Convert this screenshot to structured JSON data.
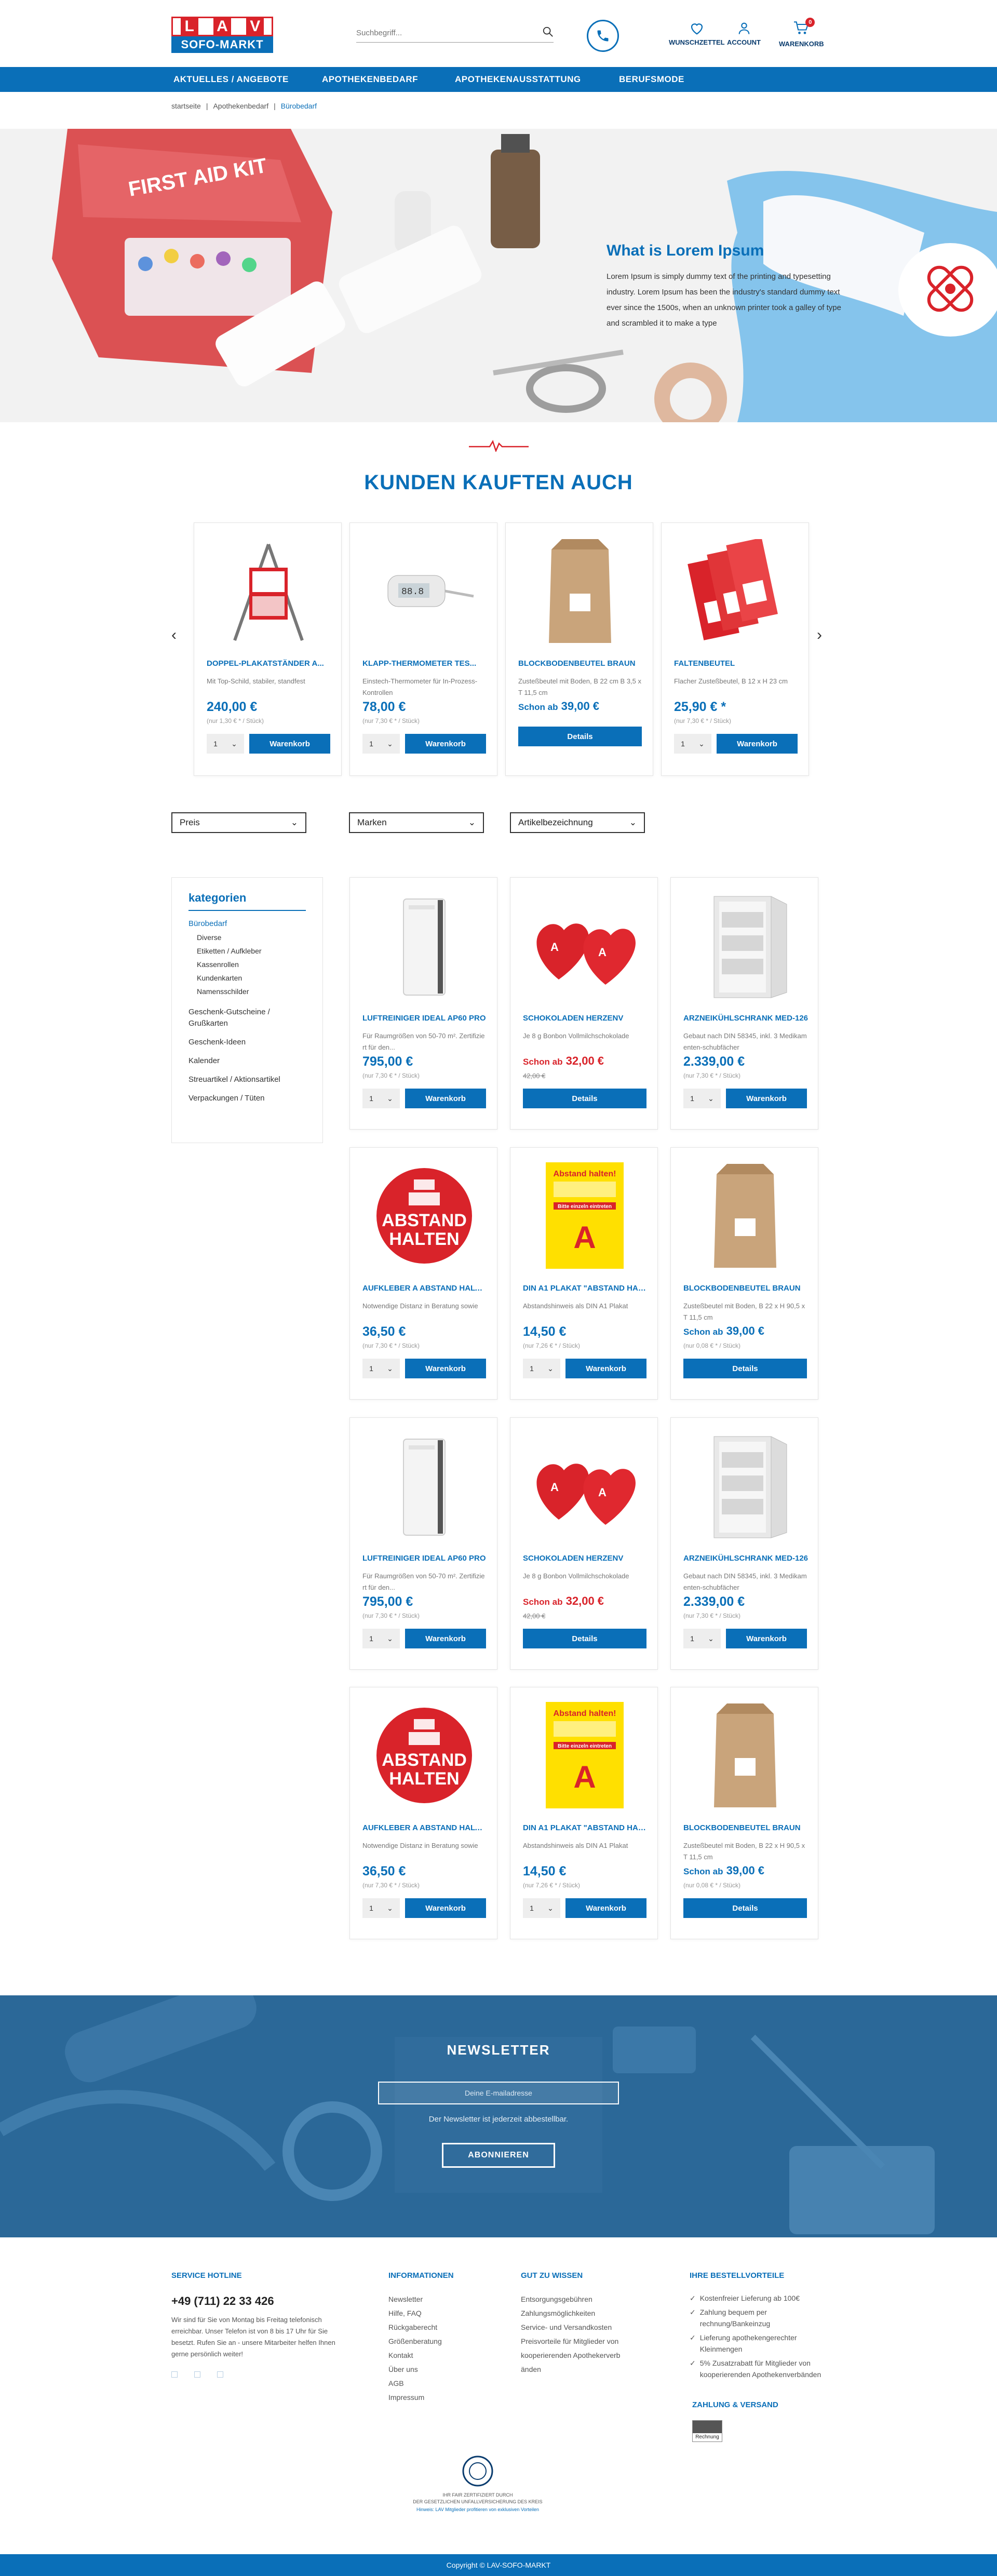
{
  "header": {
    "logo_top": [
      "L",
      "A",
      "V"
    ],
    "logo_bottom": "SOFO-MARKT",
    "search_placeholder": "Suchbegriff...",
    "wishlist_label": "WUNSCHZETTEL",
    "account_label": "ACCOUNT",
    "cart_label": "WARENKORB",
    "cart_count": "0"
  },
  "nav": [
    "AKTUELLES / ANGEBOTE",
    "APOTHEKENBEDARF",
    "APOTHEKENAUSSTATTUNG",
    "BERUFSMODE"
  ],
  "breadcrumb": [
    "startseite",
    "Apothekenbedarf",
    "Bürobedarf"
  ],
  "hero": {
    "title": "What is Lorem Ipsum",
    "text": "Lorem Ipsum is simply dummy text of the printing and typesetting industry. Lorem Ipsum has been the industry's standard dummy text ever since the 1500s, when an unknown printer took a galley of type and scrambled it to make a type",
    "bag_text": "FIRST AID KIT"
  },
  "also_bought": {
    "title": "KUNDEN KAUFTEN AUCH",
    "prev": "‹",
    "next": "›",
    "products": [
      {
        "name": "DOPPEL-PLAKATSTÄNDER A...",
        "desc": "Mit Top-Schild, stabiler, standfest",
        "price": "240,00 €",
        "unit": "(nur 1,30 € * / Stück)",
        "qty": "1",
        "button": "Warenkorb"
      },
      {
        "name": "KLAPP-THERMOMETER TES...",
        "desc": "Einstech-Thermometer für In-Prozess-Kontrollen",
        "price": "78,00 €",
        "unit": "(nur 7,30 € * / Stück)",
        "qty": "1",
        "button": "Warenkorb"
      },
      {
        "name": "BLOCKBODENBEUTEL BRAUN",
        "desc": "Zusteßbeutel mit Boden, B 22 cm B 3,5 x T 11,5 cm",
        "price_prefix": "Schon ab",
        "price": "39,00 €",
        "button": "Details"
      },
      {
        "name": "FALTENBEUTEL",
        "desc": "Flacher Zusteßbeutel, B 12 x H 23 cm",
        "price": "25,90 € *",
        "unit": "(nur 7,30 € * / Stück)",
        "qty": "1",
        "button": "Warenkorb"
      }
    ]
  },
  "filters": [
    "Preis",
    "Marken",
    "Artikelbezeichnung"
  ],
  "sidebar": {
    "title": "kategorien",
    "active": "Bürobedarf",
    "sub": [
      "Diverse",
      "Etiketten / Aufkleber",
      "Kassenrollen",
      "Kundenkarten",
      "Namensschilder"
    ],
    "items": [
      "Geschenk-Gutscheine / Grußkarten",
      "Geschenk-Ideen",
      "Kalender",
      "Streuartikel / Aktionsartikel",
      "Verpackungen / Tüten"
    ]
  },
  "grid_products": [
    {
      "name": "LUFTREINIGER IDEAL AP60 PRO",
      "desc": "Für Raumgrößen von 50-70 m². Zertifizie rt für den...",
      "price": "795,00 €",
      "unit": "(nur 7,30 € * / Stück)",
      "qty": "1",
      "button": "Warenkorb",
      "img": "purifier"
    },
    {
      "name": "SCHOKOLADEN HERZENV",
      "desc": "Je 8 g Bonbon Vollmilchschokolade",
      "price_prefix": "Schon ab",
      "price": "32,00 €",
      "old": "42,00 €",
      "button": "Details",
      "img": "hearts"
    },
    {
      "name": "ARZNEIKÜHLSCHRANK MED-126",
      "desc": "Gebaut nach DIN 58345, inkl. 3 Medikam enten-schubfächer",
      "price": "2.339,00 €",
      "unit": "(nur 7,30 € * / Stück)",
      "qty": "1",
      "button": "Warenkorb",
      "img": "fridge"
    },
    {
      "name": "AUFKLEBER A ABSTAND HALTEN",
      "desc": "Notwendige Distanz in Beratung sowie",
      "price": "36,50 €",
      "unit": "(nur 7,30 € * / Stück)",
      "qty": "1",
      "button": "Warenkorb",
      "img": "sticker"
    },
    {
      "name": "DIN A1 PLAKAT \"ABSTAND HAL...",
      "desc": "Abstandshinweis als DIN A1 Plakat",
      "price": "14,50 €",
      "unit": "(nur 7,26 € * / Stück)",
      "qty": "1",
      "button": "Warenkorb",
      "img": "poster"
    },
    {
      "name": "BLOCKBODENBEUTEL BRAUN",
      "desc": "Zusteßbeutel mit Boden, B 22 x H 90,5 x T 11,5 cm",
      "price_prefix": "Schon ab",
      "price": "39,00 €",
      "unit": "(nur 0,08 € * / Stück)",
      "button": "Details",
      "img": "bag"
    },
    {
      "name": "LUFTREINIGER IDEAL AP60 PRO",
      "desc": "Für Raumgrößen von 50-70 m². Zertifizie rt für den...",
      "price": "795,00 €",
      "unit": "(nur 7,30 € * / Stück)",
      "qty": "1",
      "button": "Warenkorb",
      "img": "purifier"
    },
    {
      "name": "SCHOKOLADEN HERZENV",
      "desc": "Je 8 g Bonbon Vollmilchschokolade",
      "price_prefix": "Schon ab",
      "price": "32,00 €",
      "old": "42,00 €",
      "button": "Details",
      "img": "hearts"
    },
    {
      "name": "ARZNEIKÜHLSCHRANK MED-126",
      "desc": "Gebaut nach DIN 58345, inkl. 3 Medikam enten-schubfächer",
      "price": "2.339,00 €",
      "unit": "(nur 7,30 € * / Stück)",
      "qty": "1",
      "button": "Warenkorb",
      "img": "fridge"
    },
    {
      "name": "AUFKLEBER A ABSTAND HALTEN",
      "desc": "Notwendige Distanz in Beratung sowie",
      "price": "36,50 €",
      "unit": "(nur 7,30 € * / Stück)",
      "qty": "1",
      "button": "Warenkorb",
      "img": "sticker"
    },
    {
      "name": "DIN A1 PLAKAT \"ABSTAND HAL...",
      "desc": "Abstandshinweis als DIN A1 Plakat",
      "price": "14,50 €",
      "unit": "(nur 7,26 € * / Stück)",
      "qty": "1",
      "button": "Warenkorb",
      "img": "poster"
    },
    {
      "name": "BLOCKBODENBEUTEL BRAUN",
      "desc": "Zusteßbeutel mit Boden, B 22 x H 90,5 x T 11,5 cm",
      "price_prefix": "Schon ab",
      "price": "39,00 €",
      "unit": "(nur 0,08 € * / Stück)",
      "button": "Details",
      "img": "bag"
    }
  ],
  "sticker_text": [
    "ABSTAND",
    "HALTEN"
  ],
  "poster_text": {
    "title": "Abstand halten!",
    "line": "Bitte einzeln eintreten"
  },
  "newsletter": {
    "title": "NEWSLETTER",
    "placeholder": "Deine E-mailadresse",
    "note": "Der Newsletter ist jederzeit abbestellbar.",
    "button": "ABONNIEREN"
  },
  "footer": {
    "hotline_title": "SERVICE HOTLINE",
    "phone": "+49 (711) 22 33 426",
    "hotline_text": "Wir sind für Sie von Montag bis Freitag telefonisch erreichbar. Unser Telefon ist von 8 bis 17 Uhr für Sie besetzt. Rufen Sie an - unsere Mitarbeiter helfen Ihnen gerne persönlich weiter!",
    "info_title": "INFORMATIONEN",
    "info_links": [
      "Newsletter",
      "Hilfe, FAQ",
      "Rückgaberecht",
      "Größenberatung",
      "Kontakt",
      "Über uns",
      "AGB",
      "Impressum"
    ],
    "know_title": "GUT ZU WISSEN",
    "know_links": [
      "Entsorgungsgebühren",
      "Zahlungsmöglichkeiten",
      "Service- und Versandkosten",
      "Preisvorteile für Mitglieder von kooperierenden Apothekerverb änden"
    ],
    "adv_title": "IHRE BESTELLVORTEILE",
    "adv_items": [
      "Kostenfreier Lieferung ab 100€",
      "Zahlung bequem per rechnung/Bankeinzug",
      "Lieferung apothekengerechter Kleinmengen",
      "5% Zusatzrabatt für Mitglieder von kooperierenden Apothekenverbänden"
    ],
    "pay_title": "ZAHLUNG & VERSAND",
    "pay_badge": "Rechnung",
    "seal_lines": [
      "IHR FAIR ZERTIFIZIERT DURCH",
      "DER GESETZLICHEN UNFALLVERSICHERUNG DES KREIS",
      "Hinweis: LAV Mitglieder profitieren von exklusiven Vorteilen"
    ],
    "copyright": "Copyright © LAV-SOFO-MARKT"
  }
}
